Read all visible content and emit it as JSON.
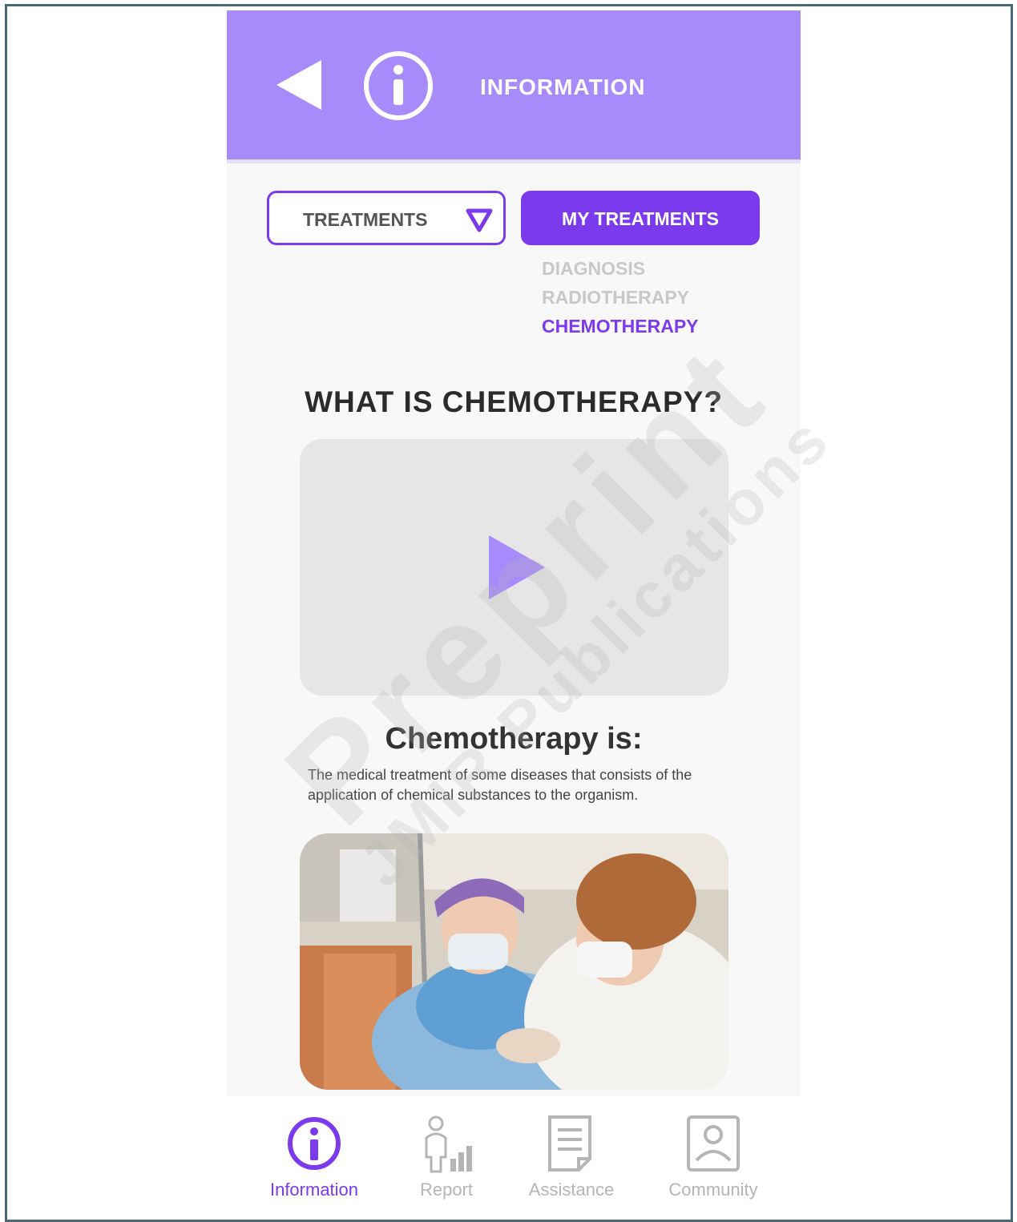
{
  "header": {
    "title": "INFORMATION",
    "back_icon": "back-triangle-icon",
    "info_icon": "info-circle-icon"
  },
  "controls": {
    "treatments_label": "TREATMENTS",
    "my_treatments_label": "MY TREATMENTS"
  },
  "submenu": {
    "items": [
      {
        "label": "DIAGNOSIS",
        "state": "inactive"
      },
      {
        "label": "RADIOTHERAPY",
        "state": "inactive"
      },
      {
        "label": "CHEMOTHERAPY",
        "state": "active"
      }
    ]
  },
  "content": {
    "heading": "WHAT IS CHEMOTHERAPY?",
    "definition_title": "Chemotherapy is:",
    "definition_text": "The medical treatment of some diseases that consists of the application of chemical substances to the organism."
  },
  "bottom_nav": {
    "items": [
      {
        "label": "Information",
        "icon": "info-icon",
        "active": true
      },
      {
        "label": "Report",
        "icon": "report-person-chart-icon",
        "active": false
      },
      {
        "label": "Assistance",
        "icon": "document-icon",
        "active": false
      },
      {
        "label": "Community",
        "icon": "profile-icon",
        "active": false
      }
    ]
  },
  "watermark": {
    "main": "Preprint",
    "sub": "JMIR Publications"
  },
  "colors": {
    "header_bg": "#a78bfa",
    "accent": "#7c3aed",
    "inactive": "#b5b5b5"
  }
}
